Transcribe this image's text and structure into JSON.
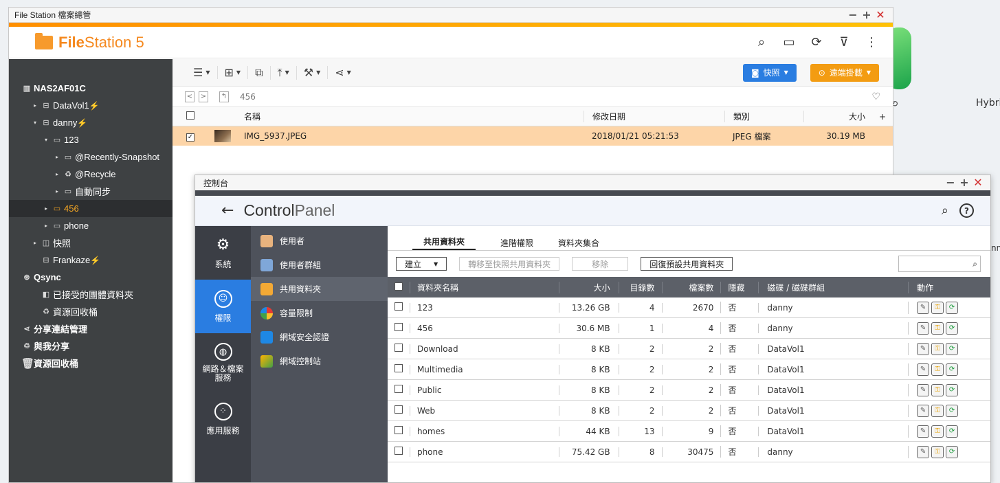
{
  "desktop": {
    "label_right": "Hybri",
    "label_right2": "nn"
  },
  "file_station": {
    "window_title": "File Station 檔案總管",
    "logo_bold": "File",
    "logo_light": "Station 5",
    "toolbar": {
      "snapshot_label": "快照",
      "remote_mount_label": "遠端掛載"
    },
    "path": "456",
    "columns": {
      "name": "名稱",
      "modified": "修改日期",
      "type": "類別",
      "size": "大小"
    },
    "files": [
      {
        "name": "IMG_5937.JPEG",
        "modified": "2018/01/21 05:21:53",
        "type": "JPEG 檔案",
        "size": "30.19 MB"
      }
    ],
    "tree": {
      "root": "NAS2AF01C",
      "datavol1": "DataVol1",
      "danny": "danny",
      "f123": "123",
      "recently_snapshot": "@Recently-Snapshot",
      "recycle": "@Recycle",
      "auto_sync": "自動同步",
      "f456": "456",
      "phone": "phone",
      "snapshot": "快照",
      "frankaze": "Frankaze",
      "qsync": "Qsync",
      "team_folder": "已接受的團體資料夾",
      "recycle_bin": "資源回收桶",
      "share_link": "分享連結管理",
      "shared_with_me": "與我分享",
      "trash": "資源回收桶"
    }
  },
  "control_panel": {
    "window_title": "控制台",
    "brand_bold": "Control",
    "brand_light": "Panel",
    "categories": [
      {
        "label": "系統"
      },
      {
        "label": "權限"
      },
      {
        "label": "網路＆檔案服務"
      },
      {
        "label": "應用服務"
      }
    ],
    "sub_items": [
      {
        "label": "使用者"
      },
      {
        "label": "使用者群組"
      },
      {
        "label": "共用資料夾"
      },
      {
        "label": "容量限制"
      },
      {
        "label": "網域安全認證"
      },
      {
        "label": "網域控制站"
      }
    ],
    "tabs": [
      {
        "label": "共用資料夾"
      },
      {
        "label": "進階權限"
      },
      {
        "label": "資料夾集合"
      }
    ],
    "actions": {
      "create": "建立",
      "move_to_snapshot": "轉移至快照共用資料夾",
      "remove": "移除",
      "restore_default": "回復預設共用資料夾"
    },
    "columns": {
      "name": "資料夾名稱",
      "size": "大小",
      "dirs": "目錄數",
      "files": "檔案數",
      "hidden": "隱藏",
      "volume": "磁碟 / 磁碟群組",
      "action": "動作"
    },
    "folders": [
      {
        "name": "123",
        "size": "13.26 GB",
        "dirs": "4",
        "files": "2670",
        "hidden": "否",
        "volume": "danny"
      },
      {
        "name": "456",
        "size": "30.6 MB",
        "dirs": "1",
        "files": "4",
        "hidden": "否",
        "volume": "danny"
      },
      {
        "name": "Download",
        "size": "8 KB",
        "dirs": "2",
        "files": "2",
        "hidden": "否",
        "volume": "DataVol1"
      },
      {
        "name": "Multimedia",
        "size": "8 KB",
        "dirs": "2",
        "files": "2",
        "hidden": "否",
        "volume": "DataVol1"
      },
      {
        "name": "Public",
        "size": "8 KB",
        "dirs": "2",
        "files": "2",
        "hidden": "否",
        "volume": "DataVol1"
      },
      {
        "name": "Web",
        "size": "8 KB",
        "dirs": "2",
        "files": "2",
        "hidden": "否",
        "volume": "DataVol1"
      },
      {
        "name": "homes",
        "size": "44 KB",
        "dirs": "13",
        "files": "9",
        "hidden": "否",
        "volume": "DataVol1"
      },
      {
        "name": "phone",
        "size": "75.42 GB",
        "dirs": "8",
        "files": "30475",
        "hidden": "否",
        "volume": "danny"
      }
    ]
  }
}
